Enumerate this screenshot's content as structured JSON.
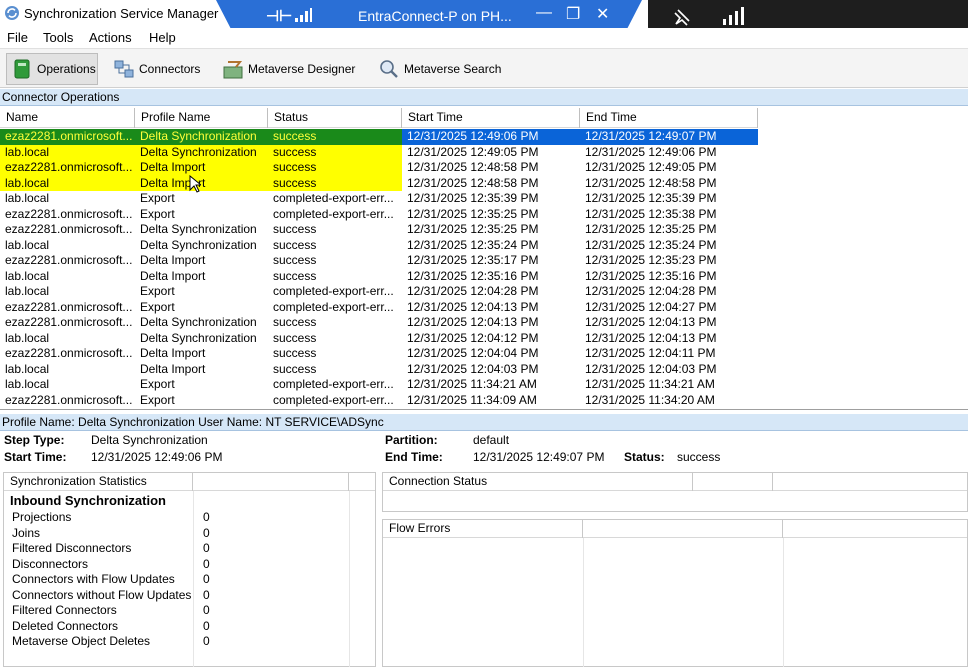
{
  "window": {
    "title": "Synchronization Service Manager",
    "remote_connection": "EntraConnect-P on PH..."
  },
  "menu": [
    "File",
    "Tools",
    "Actions",
    "Help"
  ],
  "toolbar": {
    "operations": "Operations",
    "connectors": "Connectors",
    "metaverse_designer": "Metaverse Designer",
    "metaverse_search": "Metaverse Search"
  },
  "connector_operations": {
    "section_title": "Connector Operations",
    "columns": [
      "Name",
      "Profile Name",
      "Status",
      "Start Time",
      "End Time"
    ],
    "rows": [
      [
        "ezaz2281.onmicrosoft...",
        "Delta Synchronization",
        "success",
        "12/31/2025 12:49:06 PM",
        "12/31/2025 12:49:07 PM"
      ],
      [
        "lab.local",
        "Delta Synchronization",
        "success",
        "12/31/2025 12:49:05 PM",
        "12/31/2025 12:49:06 PM"
      ],
      [
        "ezaz2281.onmicrosoft...",
        "Delta Import",
        "success",
        "12/31/2025 12:48:58 PM",
        "12/31/2025 12:49:05 PM"
      ],
      [
        "lab.local",
        "Delta Import",
        "success",
        "12/31/2025 12:48:58 PM",
        "12/31/2025 12:48:58 PM"
      ],
      [
        "lab.local",
        "Export",
        "completed-export-err...",
        "12/31/2025 12:35:39 PM",
        "12/31/2025 12:35:39 PM"
      ],
      [
        "ezaz2281.onmicrosoft...",
        "Export",
        "completed-export-err...",
        "12/31/2025 12:35:25 PM",
        "12/31/2025 12:35:38 PM"
      ],
      [
        "ezaz2281.onmicrosoft...",
        "Delta Synchronization",
        "success",
        "12/31/2025 12:35:25 PM",
        "12/31/2025 12:35:25 PM"
      ],
      [
        "lab.local",
        "Delta Synchronization",
        "success",
        "12/31/2025 12:35:24 PM",
        "12/31/2025 12:35:24 PM"
      ],
      [
        "ezaz2281.onmicrosoft...",
        "Delta Import",
        "success",
        "12/31/2025 12:35:17 PM",
        "12/31/2025 12:35:23 PM"
      ],
      [
        "lab.local",
        "Delta Import",
        "success",
        "12/31/2025 12:35:16 PM",
        "12/31/2025 12:35:16 PM"
      ],
      [
        "lab.local",
        "Export",
        "completed-export-err...",
        "12/31/2025 12:04:28 PM",
        "12/31/2025 12:04:28 PM"
      ],
      [
        "ezaz2281.onmicrosoft...",
        "Export",
        "completed-export-err...",
        "12/31/2025 12:04:13 PM",
        "12/31/2025 12:04:27 PM"
      ],
      [
        "ezaz2281.onmicrosoft...",
        "Delta Synchronization",
        "success",
        "12/31/2025 12:04:13 PM",
        "12/31/2025 12:04:13 PM"
      ],
      [
        "lab.local",
        "Delta Synchronization",
        "success",
        "12/31/2025 12:04:12 PM",
        "12/31/2025 12:04:13 PM"
      ],
      [
        "ezaz2281.onmicrosoft...",
        "Delta Import",
        "success",
        "12/31/2025 12:04:04 PM",
        "12/31/2025 12:04:11 PM"
      ],
      [
        "lab.local",
        "Delta Import",
        "success",
        "12/31/2025 12:04:03 PM",
        "12/31/2025 12:04:03 PM"
      ],
      [
        "lab.local",
        "Export",
        "completed-export-err...",
        "12/31/2025 11:34:21 AM",
        "12/31/2025 11:34:21 AM"
      ],
      [
        "ezaz2281.onmicrosoft...",
        "Export",
        "completed-export-err...",
        "12/31/2025 11:34:09 AM",
        "12/31/2025 11:34:20 AM"
      ]
    ]
  },
  "profile_bar": "Profile Name: Delta Synchronization  User Name: NT SERVICE\\ADSync",
  "details": {
    "step_type_label": "Step Type:",
    "step_type": "Delta Synchronization",
    "start_time_label": "Start Time:",
    "start_time": "12/31/2025 12:49:06 PM",
    "partition_label": "Partition:",
    "partition": "default",
    "end_time_label": "End Time:",
    "end_time": "12/31/2025 12:49:07 PM",
    "status_label": "Status:",
    "status": "success"
  },
  "sync_stats": {
    "header": "Synchronization Statistics",
    "group": "Inbound Synchronization",
    "rows": [
      [
        "Projections",
        "0"
      ],
      [
        "Joins",
        "0"
      ],
      [
        "Filtered Disconnectors",
        "0"
      ],
      [
        "Disconnectors",
        "0"
      ],
      [
        "Connectors with Flow Updates",
        "0"
      ],
      [
        "Connectors without Flow Updates",
        "0"
      ],
      [
        "Filtered Connectors",
        "0"
      ],
      [
        "Deleted Connectors",
        "0"
      ],
      [
        "Metaverse Object Deletes",
        "0"
      ]
    ]
  },
  "connection_status": {
    "header": "Connection Status"
  },
  "flow_errors": {
    "header": "Flow Errors"
  },
  "colors": {
    "highlight": "#ffff00",
    "selected_green": "#1a8a1a",
    "selected_blue": "#0a64d8",
    "rdp_bar": "#2a6fd6",
    "section_header": "#d6e7f7"
  }
}
